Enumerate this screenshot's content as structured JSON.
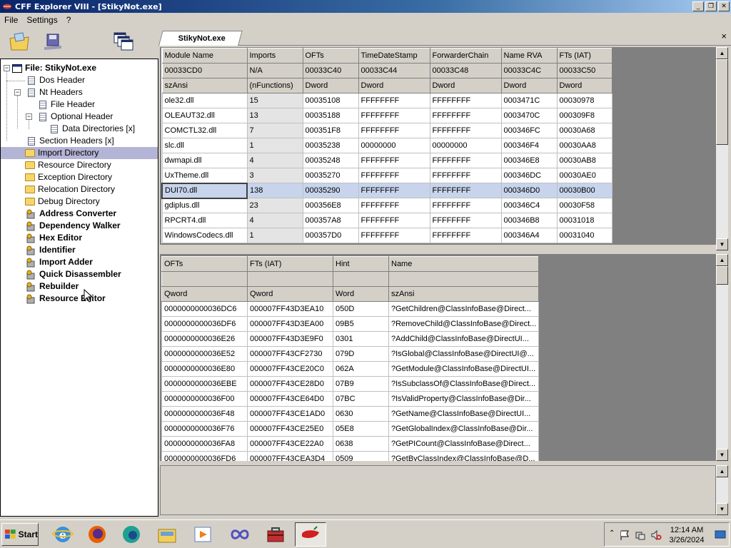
{
  "window": {
    "title": "CFF Explorer VIII - [StikyNot.exe]",
    "minimize": "_",
    "restore": "❐",
    "close": "✕"
  },
  "menu": [
    "File",
    "Settings",
    "?"
  ],
  "tabs": {
    "active": "StikyNot.exe",
    "close": "×"
  },
  "tree": {
    "root": "File: StikyNot.exe",
    "items": [
      {
        "label": "Dos Header"
      },
      {
        "label": "Nt Headers"
      },
      {
        "label": "File Header"
      },
      {
        "label": "Optional Header"
      },
      {
        "label": "Data Directories [x]"
      },
      {
        "label": "Section Headers [x]"
      },
      {
        "label": "Import Directory"
      },
      {
        "label": "Resource Directory"
      },
      {
        "label": "Exception Directory"
      },
      {
        "label": "Relocation Directory"
      },
      {
        "label": "Debug Directory"
      },
      {
        "label": "Address Converter"
      },
      {
        "label": "Dependency Walker"
      },
      {
        "label": "Hex Editor"
      },
      {
        "label": "Identifier"
      },
      {
        "label": "Import Adder"
      },
      {
        "label": "Quick Disassembler"
      },
      {
        "label": "Rebuilder"
      },
      {
        "label": "Resource Editor"
      }
    ]
  },
  "import_table": {
    "headers": [
      "Module Name",
      "Imports",
      "OFTs",
      "TimeDateStamp",
      "ForwarderChain",
      "Name RVA",
      "FTs (IAT)"
    ],
    "offsets": [
      "00033CD0",
      "N/A",
      "00033C40",
      "00033C44",
      "00033C48",
      "00033C4C",
      "00033C50"
    ],
    "types": [
      "szAnsi",
      "(nFunctions)",
      "Dword",
      "Dword",
      "Dword",
      "Dword",
      "Dword"
    ],
    "rows": [
      [
        "ole32.dll",
        "15",
        "00035108",
        "FFFFFFFF",
        "FFFFFFFF",
        "0003471C",
        "00030978"
      ],
      [
        "OLEAUT32.dll",
        "13",
        "00035188",
        "FFFFFFFF",
        "FFFFFFFF",
        "0003470C",
        "000309F8"
      ],
      [
        "COMCTL32.dll",
        "7",
        "000351F8",
        "FFFFFFFF",
        "FFFFFFFF",
        "000346FC",
        "00030A68"
      ],
      [
        "slc.dll",
        "1",
        "00035238",
        "00000000",
        "00000000",
        "000346F4",
        "00030AA8"
      ],
      [
        "dwmapi.dll",
        "4",
        "00035248",
        "FFFFFFFF",
        "FFFFFFFF",
        "000346E8",
        "00030AB8"
      ],
      [
        "UxTheme.dll",
        "3",
        "00035270",
        "FFFFFFFF",
        "FFFFFFFF",
        "000346DC",
        "00030AE0"
      ],
      [
        "DUI70.dll",
        "138",
        "00035290",
        "FFFFFFFF",
        "FFFFFFFF",
        "000346D0",
        "00030B00"
      ],
      [
        "gdiplus.dll",
        "23",
        "000356E8",
        "FFFFFFFF",
        "FFFFFFFF",
        "000346C4",
        "00030F58"
      ],
      [
        "RPCRT4.dll",
        "4",
        "000357A8",
        "FFFFFFFF",
        "FFFFFFFF",
        "000346B8",
        "00031018"
      ],
      [
        "WindowsCodecs.dll",
        "1",
        "000357D0",
        "FFFFFFFF",
        "FFFFFFFF",
        "000346A4",
        "00031040"
      ]
    ],
    "selected_row": 6
  },
  "function_table": {
    "headers": [
      "OFTs",
      "FTs (IAT)",
      "Hint",
      "Name"
    ],
    "offsets": [
      "",
      "",
      "",
      ""
    ],
    "types": [
      "Qword",
      "Qword",
      "Word",
      "szAnsi"
    ],
    "rows": [
      [
        "0000000000036DC6",
        "000007FF43D3EA10",
        "050D",
        "?GetChildren@ClassInfoBase@Direct..."
      ],
      [
        "0000000000036DF6",
        "000007FF43D3EA00",
        "09B5",
        "?RemoveChild@ClassInfoBase@Direct..."
      ],
      [
        "0000000000036E26",
        "000007FF43D3E9F0",
        "0301",
        "?AddChild@ClassInfoBase@DirectUI..."
      ],
      [
        "0000000000036E52",
        "000007FF43CF2730",
        "079D",
        "?IsGlobal@ClassInfoBase@DirectUI@..."
      ],
      [
        "0000000000036E80",
        "000007FF43CE20C0",
        "062A",
        "?GetModule@ClassInfoBase@DirectUI..."
      ],
      [
        "0000000000036EBE",
        "000007FF43CE28D0",
        "07B9",
        "?IsSubclassOf@ClassInfoBase@Direct..."
      ],
      [
        "0000000000036F00",
        "000007FF43CE64D0",
        "07BC",
        "?IsValidProperty@ClassInfoBase@Dir..."
      ],
      [
        "0000000000036F48",
        "000007FF43CE1AD0",
        "0630",
        "?GetName@ClassInfoBase@DirectUI..."
      ],
      [
        "0000000000036F76",
        "000007FF43CE25E0",
        "05E8",
        "?GetGlobalIndex@ClassInfoBase@Dir..."
      ],
      [
        "0000000000036FA8",
        "000007FF43CE22A0",
        "0638",
        "?GetPICount@ClassInfoBase@Direct..."
      ],
      [
        "0000000000036FD6",
        "000007FF43CEA3D4",
        "0509",
        "?GetByClassIndex@ClassInfoBase@D..."
      ]
    ]
  },
  "taskbar": {
    "start": "Start",
    "time": "12:14 AM",
    "date": "3/26/2024"
  },
  "colors": {
    "selection": "#b4b4d6",
    "grid_background": "#808080",
    "title_bar": "#0a246a"
  }
}
